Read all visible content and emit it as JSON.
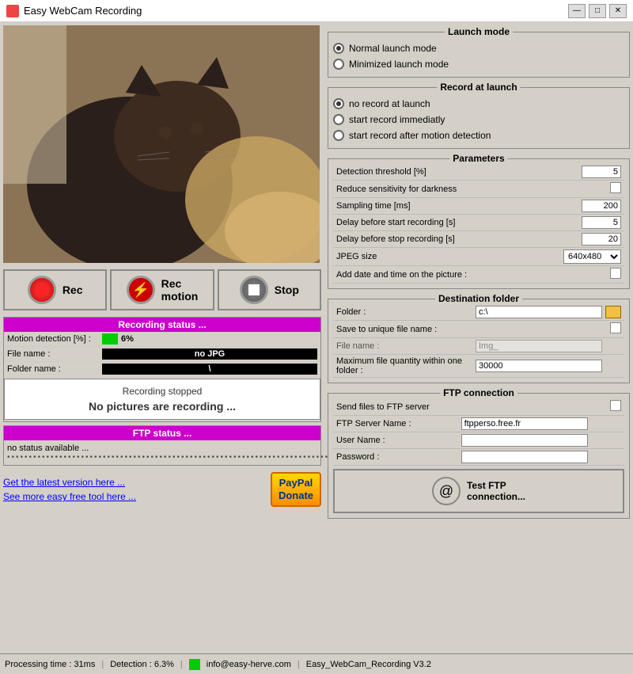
{
  "titleBar": {
    "title": "Easy WebCam Recording",
    "minimize": "—",
    "maximize": "□",
    "close": "✕"
  },
  "controls": {
    "rec_label": "Rec",
    "rec_motion_label": "Rec\nmotion",
    "stop_label": "Stop"
  },
  "recordingStatus": {
    "header": "Recording status ...",
    "motion_label": "Motion detection [%] :",
    "motion_value": "6%",
    "filename_label": "File name :",
    "filename_value": "no JPG",
    "folder_label": "Folder name :",
    "folder_value": "\\",
    "stopped_title": "Recording stopped",
    "stopped_sub": "No pictures are recording ..."
  },
  "ftpStatus": {
    "header": "FTP status ...",
    "value": "no status available ...",
    "dots": "••••••••••••••••••••••••••••••••••••••••••••••••••••••••••••••••••••••••••••••••••••••••"
  },
  "bottomLinks": {
    "latest_version": "Get the latest version here ...",
    "more_tools": "See more easy free tool here ...",
    "paypal": "PayPal\nDonate"
  },
  "launchMode": {
    "title": "Launch mode",
    "options": [
      {
        "label": "Normal launch mode",
        "selected": true
      },
      {
        "label": "Minimized launch mode",
        "selected": false
      }
    ]
  },
  "recordAtLaunch": {
    "title": "Record at launch",
    "options": [
      {
        "label": "no record at launch",
        "selected": true
      },
      {
        "label": "start record immediatly",
        "selected": false
      },
      {
        "label": "start record after motion detection",
        "selected": false
      }
    ]
  },
  "parameters": {
    "title": "Parameters",
    "rows": [
      {
        "label": "Detection threshold [%]",
        "value": "5",
        "type": "number"
      },
      {
        "label": "Reduce sensitivity for darkness",
        "value": "",
        "type": "checkbox"
      },
      {
        "label": "Sampling time [ms]",
        "value": "200",
        "type": "number"
      },
      {
        "label": "Delay before start recording [s]",
        "value": "5",
        "type": "number"
      },
      {
        "label": "Delay before stop recording [s]",
        "value": "20",
        "type": "number"
      },
      {
        "label": "JPEG size",
        "value": "640x480",
        "type": "select"
      },
      {
        "label": "Add date and time on the picture :",
        "value": "",
        "type": "checkbox"
      }
    ]
  },
  "destinationFolder": {
    "title": "Destination folder",
    "folder_label": "Folder :",
    "folder_value": "c:\\",
    "unique_label": "Save to unique file name :",
    "filename_label": "File name :",
    "filename_value": "Img_",
    "max_label": "Maximum file quantity within one folder :",
    "max_value": "30000"
  },
  "ftpConnection": {
    "title": "FTP connection",
    "send_label": "Send files to FTP server",
    "server_label": "FTP Server Name :",
    "server_value": "ftpperso.free.fr",
    "user_label": "User Name :",
    "user_value": "",
    "pass_label": "Password :",
    "pass_value": "",
    "test_btn": "Test FTP\nconnection..."
  },
  "statusBar": {
    "processing": "Processing time : 31ms",
    "detection": "Detection : 6.3%",
    "email": "info@easy-herve.com",
    "version": "Easy_WebCam_Recording V3.2"
  }
}
